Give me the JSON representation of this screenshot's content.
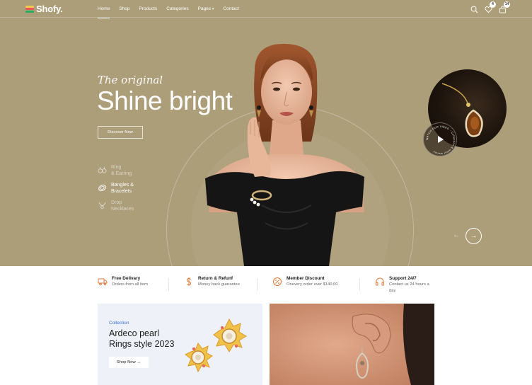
{
  "brand": {
    "name": "Shofy.",
    "colors": [
      "#f2c94c",
      "#eb5757",
      "#27ae60"
    ]
  },
  "nav": {
    "items": [
      {
        "label": "Home",
        "active": true
      },
      {
        "label": "Shop"
      },
      {
        "label": "Products"
      },
      {
        "label": "Categories"
      },
      {
        "label": "Pages"
      },
      {
        "label": "Contact"
      }
    ]
  },
  "header_icons": {
    "search": "search-icon",
    "wishlist": {
      "icon": "heart-icon",
      "count": "4"
    },
    "cart": {
      "icon": "bag-icon",
      "count": "14"
    }
  },
  "hero": {
    "background": "#ad9e7a",
    "subtitle": "The original",
    "title": "Shine bright",
    "cta": "Discover Now",
    "categories": [
      {
        "icon": "ring-earring-icon",
        "label_line1": "Ring",
        "label_line2": "& Earring",
        "active": false
      },
      {
        "icon": "bangle-icon",
        "label_line1": "Bangles &",
        "label_line2": "Bracelets",
        "active": true
      },
      {
        "icon": "necklace-icon",
        "label_line1": "Drop",
        "label_line2": "Necklaces",
        "active": false
      }
    ],
    "video_caption": "WATCH OUR VIDEO · Collection & other stories"
  },
  "features": [
    {
      "icon": "truck-icon",
      "title": "Free Delivary",
      "desc": "Orders from all item"
    },
    {
      "icon": "dollar-icon",
      "title": "Return & Refunf",
      "desc": "Money back guarantee"
    },
    {
      "icon": "discount-icon",
      "title": "Member Discount",
      "desc": "Onevery order over $140.00"
    },
    {
      "icon": "headset-icon",
      "title": "Support 24/7",
      "desc": "Contact us 24 hours a day"
    }
  ],
  "promo": {
    "kicker": "Collection",
    "title_line1": "Ardeco pearl",
    "title_line2": "Rings style 2023",
    "cta": "Shop Now →",
    "accent": "#3b6fd3"
  },
  "accent_orange": "#e07b39"
}
